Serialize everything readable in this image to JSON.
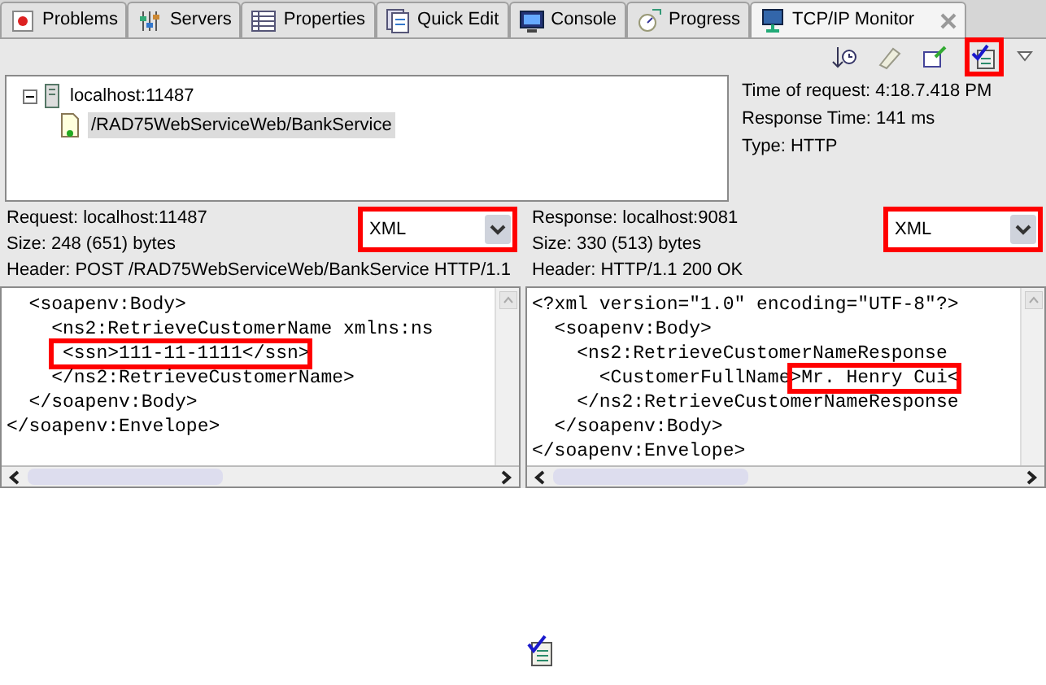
{
  "tabs": [
    {
      "label": "Problems",
      "selected": false
    },
    {
      "label": "Servers",
      "selected": false
    },
    {
      "label": "Properties",
      "selected": false
    },
    {
      "label": "Quick Edit",
      "selected": false
    },
    {
      "label": "Console",
      "selected": false
    },
    {
      "label": "Progress",
      "selected": false
    },
    {
      "label": "TCP/IP Monitor",
      "selected": true
    }
  ],
  "tree": [
    {
      "label": "localhost:11487",
      "expanded": true,
      "children": [
        {
          "label": "/RAD75WebServiceWeb/BankService",
          "selected": true
        }
      ]
    }
  ],
  "info": [
    "Time of request: 4:18.7.418 PM",
    "Response Time: 141 ms",
    "Type: HTTP"
  ],
  "panes": [
    {
      "lines": [
        "Request: localhost:11487",
        "Size: 248 (651) bytes",
        "Header: POST /RAD75WebServiceWeb/BankService HTTP/1.1"
      ],
      "format": "XML",
      "format_highlighted": true,
      "code": [
        [
          {
            "text": "  <soapenv:Body>",
            "highlighted": false
          }
        ],
        [
          {
            "text": "    <ns2:RetrieveCustomerName xmlns:ns",
            "highlighted": false
          }
        ],
        [
          {
            "text": " <ssn>111-11-1111</ssn>",
            "highlighted": true
          }
        ],
        [
          {
            "text": "    </ns2:RetrieveCustomerName>",
            "highlighted": false
          }
        ],
        [
          {
            "text": "  </soapenv:Body>",
            "highlighted": false
          }
        ],
        [
          {
            "text": "</soapenv:Envelope>",
            "highlighted": false
          }
        ]
      ]
    },
    {
      "lines": [
        "Response: localhost:9081",
        "Size: 330 (513) bytes",
        "Header: HTTP/1.1 200 OK"
      ],
      "format": "XML",
      "format_highlighted": true,
      "code": [
        [
          {
            "text": "<?xml version=\"1.0\" encoding=\"UTF-8\"?>",
            "highlighted": false
          }
        ],
        [
          {
            "text": "  <soapenv:Body>",
            "highlighted": false
          }
        ],
        [
          {
            "text": "    <ns2:RetrieveCustomerNameResponse",
            "highlighted": false
          }
        ],
        [
          {
            "text": "      <CustomerFullName",
            "highlighted": false
          },
          {
            "text": ">Mr. Henry Cui<",
            "highlighted": true
          }
        ],
        [
          {
            "text": "    </ns2:RetrieveCustomerNameResponse",
            "highlighted": false
          }
        ],
        [
          {
            "text": "  </soapenv:Body>",
            "highlighted": false
          }
        ],
        [
          {
            "text": "</soapenv:Envelope>",
            "highlighted": false
          }
        ]
      ]
    }
  ],
  "toolbar": [
    {
      "highlighted": false
    },
    {
      "highlighted": false
    },
    {
      "highlighted": false
    },
    {
      "highlighted": true
    }
  ]
}
